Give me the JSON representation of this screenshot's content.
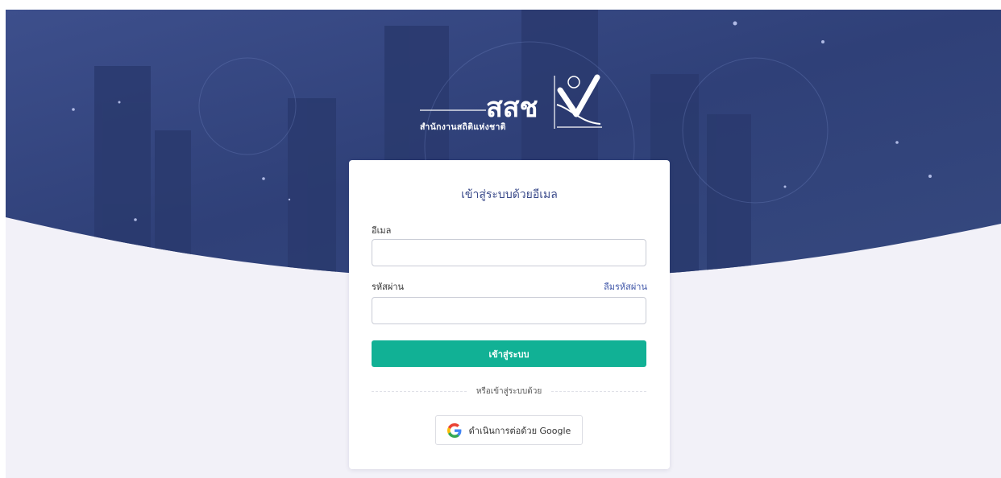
{
  "header": {
    "logo": {
      "wordmark": "สสช",
      "caption": "สำนักงานสถิติแห่งชาติ"
    }
  },
  "login": {
    "title": "เข้าสู่ระบบด้วยอีเมล",
    "email_label": "อีเมล",
    "email_value": "",
    "password_label": "รหัสผ่าน",
    "password_value": "",
    "forgot_password": "ลืมรหัสผ่าน",
    "submit_label": "เข้าสู่ระบบ",
    "divider_text": "หรือเข้าสู่ระบบด้วย",
    "google_label": "ดำเนินการต่อด้วย Google"
  },
  "colors": {
    "primary_button": "#11b195",
    "link": "#3f56a8",
    "hero_background": "#33457e",
    "page_background": "#f2f1f8"
  },
  "icons": [
    "google-icon"
  ]
}
